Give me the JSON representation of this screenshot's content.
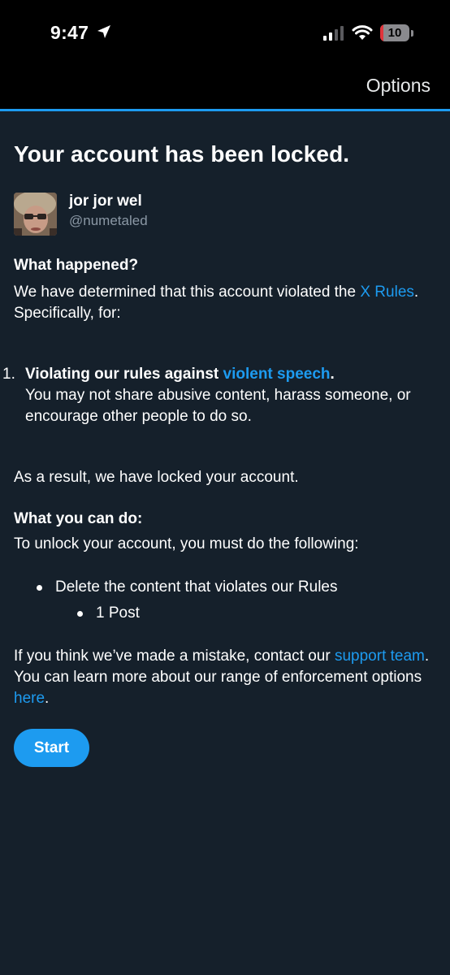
{
  "status_bar": {
    "time": "9:47",
    "battery_level": "10",
    "battery_fraction": 0.1,
    "icons": [
      "location-arrow-icon",
      "cellular-signal-icon",
      "wifi-icon",
      "battery-icon"
    ]
  },
  "topbar": {
    "options_label": "Options"
  },
  "page": {
    "title": "Your account has been locked."
  },
  "user": {
    "name": "jor jor wel",
    "handle": "@numetaled"
  },
  "what_happened": {
    "heading": "What happened?",
    "text_before_link": "We have determined that this account violated the ",
    "link": "X Rules",
    "text_after_link": ". Specifically, for:"
  },
  "violation": {
    "number": "1.",
    "title_before_link": "Violating our rules against ",
    "link": "violent speech",
    "title_after_link": ".",
    "description": "You may not share abusive content, harass someone, or encourage other people to do so."
  },
  "result": {
    "text": "As a result, we have locked your account."
  },
  "what_you_can_do": {
    "heading": "What you can do:",
    "text": "To unlock your account, you must do the following:",
    "steps": [
      {
        "label": "Delete the content that violates our Rules",
        "sub_items": [
          "1 Post"
        ]
      }
    ]
  },
  "footer_note": {
    "text_1": "If you think we’ve made a mistake, contact our ",
    "link_1": "support team",
    "text_2": ". You can learn more about our range of enforcement options ",
    "link_2": "here",
    "text_3": "."
  },
  "actions": {
    "start_label": "Start"
  },
  "colors": {
    "background": "#15202b",
    "status_bar_background": "#000000",
    "accent": "#1d9bf0",
    "secondary_text": "#8b98a5",
    "battery_low": "#e0343b"
  }
}
